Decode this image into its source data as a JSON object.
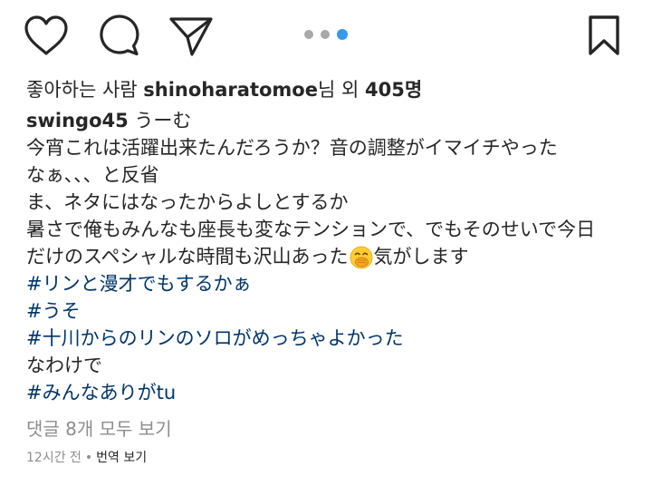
{
  "action_bar": {
    "icons": [
      "heart-icon",
      "comment-icon",
      "share-icon",
      "bookmark-icon"
    ],
    "carousel": {
      "count": 3,
      "active_index": 2
    }
  },
  "likes": {
    "prefix": "좋아하는 사람 ",
    "user": "shinoharatomoe",
    "middle": "님 외 ",
    "count": "405명"
  },
  "caption": {
    "username": "swingo45",
    "first_text": " うーむ",
    "lines": [
      "今宵これは活躍出来たんだろうか？音の調整がイマイチやった",
      "なぁ、、、と反省",
      "ま、ネタにはなったからよしとするか",
      "暑さで俺もみんなも座長も変なテンションで、でもそのせいで今日"
    ],
    "emoji_line_before": "だけのスペシャルな時間も沢山あった",
    "emoji_name": "face-with-hand-over-mouth",
    "emoji_line_after": "気がします",
    "hashtags_1": [
      "#リンと漫才でもするかぁ",
      "#うそ",
      "#十川からのリンのソロがめっちゃよかった"
    ],
    "plain_line": "なわけで",
    "hashtags_2": [
      "#みんなありがtu"
    ]
  },
  "comments": {
    "view_all": "댓글 8개 모두 보기"
  },
  "meta": {
    "time": "12시간 전",
    "separator": "•",
    "translate": "번역 보기"
  },
  "colors": {
    "text": "#262626",
    "hashtag": "#003569",
    "muted": "#8e8e8e",
    "dot_active": "#3897f0",
    "dot_inactive": "#a8a8a8"
  }
}
